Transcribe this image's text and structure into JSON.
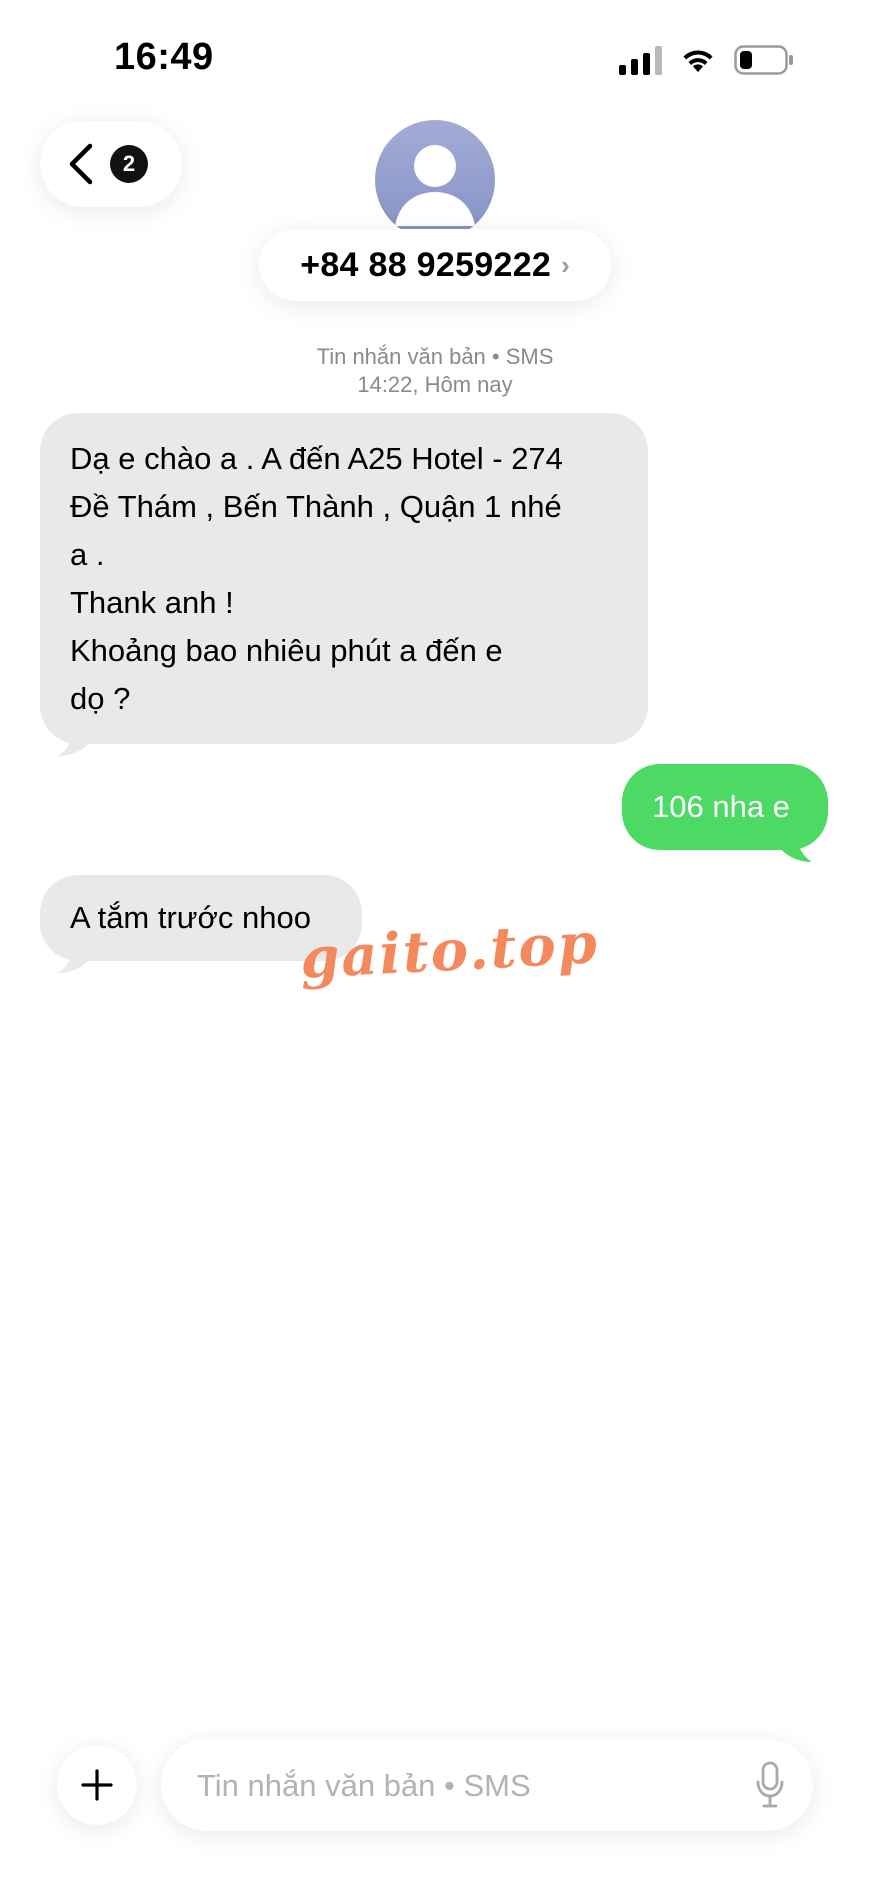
{
  "status_bar": {
    "time": "16:49",
    "signal_icon": "cellular-signal-icon",
    "wifi_icon": "wifi-icon",
    "battery_icon": "battery-icon",
    "battery_level": 0.2
  },
  "nav": {
    "back_icon": "chevron-left-icon",
    "unread_count": "2"
  },
  "contact": {
    "avatar_icon": "person-avatar-icon",
    "phone_number": "+84 88 9259222",
    "chevron": "›"
  },
  "thread": {
    "service_label": "Tin nhắn văn bản • SMS",
    "timestamp": "14:22, Hôm nay"
  },
  "messages": [
    {
      "direction": "incoming",
      "text": "Dạ e chào a . A đến A25 Hotel - 274\nĐề Thám , Bến Thành , Quận 1 nhé\na .\nThank anh !\nKhoảng bao nhiêu phút a đến e\ndọ ?"
    },
    {
      "direction": "outgoing",
      "text": "106 nha e"
    },
    {
      "direction": "incoming",
      "text": "A tắm trước nhoo"
    }
  ],
  "watermark": "gaito.top",
  "composer": {
    "add_icon": "plus-icon",
    "placeholder": "Tin nhắn văn bản • SMS",
    "value": "",
    "mic_icon": "microphone-icon"
  },
  "colors": {
    "incoming_bubble": "#e9e9eb",
    "outgoing_bubble": "#4cd964",
    "watermark": "#f4895e",
    "avatar": "#8c98c9"
  }
}
